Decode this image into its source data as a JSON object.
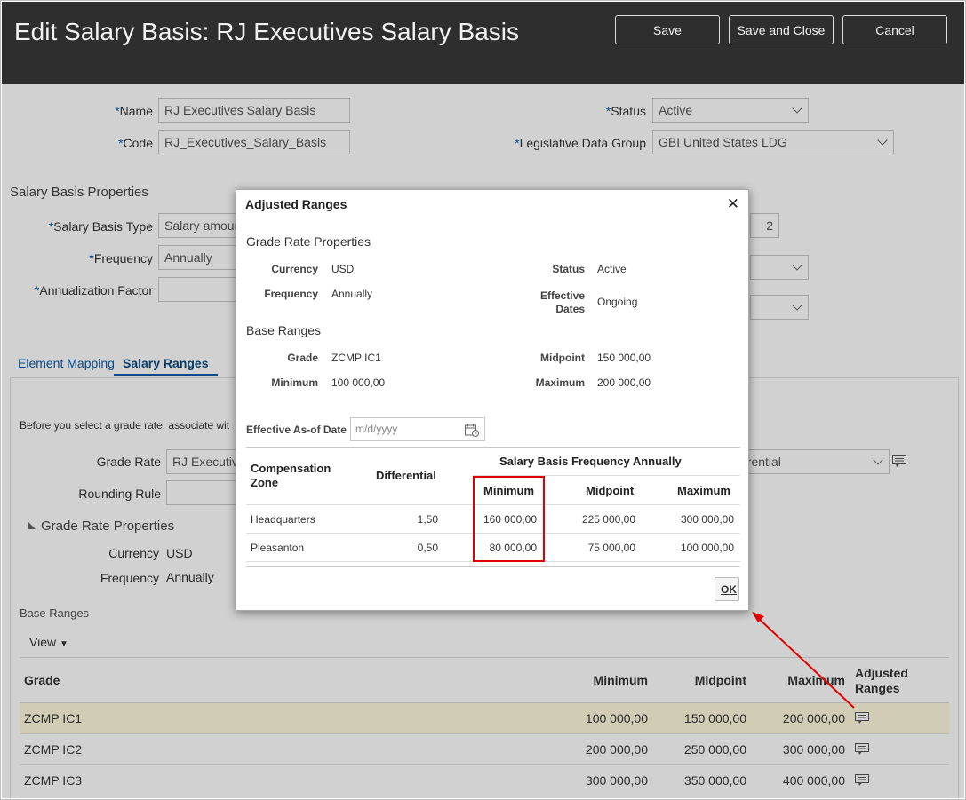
{
  "header": {
    "title": "Edit Salary Basis: RJ Executives Salary Basis",
    "save_label": "Save",
    "save_close_label": "Save and Close",
    "cancel_label": "Cancel"
  },
  "form": {
    "name_label": "Name",
    "name_value": "RJ Executives Salary Basis",
    "code_label": "Code",
    "code_value": "RJ_Executives_Salary_Basis",
    "status_label": "Status",
    "status_value": "Active",
    "ldg_label": "Legislative Data Group",
    "ldg_value": "GBI United States LDG",
    "required_mark": "*"
  },
  "properties": {
    "heading": "Salary Basis Properties",
    "type_label": "Salary Basis Type",
    "type_value": "Salary amoun",
    "frequency_label": "Frequency",
    "frequency_value": "Annually",
    "annualization_label": "Annualization Factor",
    "decimals_value": "2"
  },
  "tabs": [
    "Element Mapping",
    "Salary Ranges"
  ],
  "salary_ranges": {
    "intro": "Before you select a grade rate, associate wit",
    "grade_rate_label": "Grade Rate",
    "grade_rate_value": "RJ Executive",
    "grade_rate_right_value": "erential",
    "rounding_label": "Rounding Rule",
    "grp_heading": "Grade Rate Properties",
    "currency_label": "Currency",
    "currency_value": "USD",
    "frequency_label": "Frequency",
    "frequency_value": "Annually",
    "base_ranges_heading": "Base Ranges",
    "view_label": "View",
    "columns": [
      "Grade",
      "Minimum",
      "Midpoint",
      "Maximum",
      "Adjusted Ranges"
    ],
    "rows": [
      {
        "grade": "ZCMP IC1",
        "min": "100 000,00",
        "mid": "150 000,00",
        "max": "200 000,00"
      },
      {
        "grade": "ZCMP IC2",
        "min": "200 000,00",
        "mid": "250 000,00",
        "max": "300 000,00"
      },
      {
        "grade": "ZCMP IC3",
        "min": "300 000,00",
        "mid": "350 000,00",
        "max": "400 000,00"
      }
    ]
  },
  "dialog": {
    "title": "Adjusted Ranges",
    "close_glyph": "✕",
    "grp_heading": "Grade Rate Properties",
    "currency_label": "Currency",
    "currency_value": "USD",
    "frequency_label": "Frequency",
    "frequency_value": "Annually",
    "status_label": "Status",
    "status_value": "Active",
    "eff_label_1": "Effective",
    "eff_label_2": "Dates",
    "eff_value": "Ongoing",
    "base_heading": "Base Ranges",
    "grade_label": "Grade",
    "grade_value": "ZCMP IC1",
    "minimum_label": "Minimum",
    "minimum_value": "100 000,00",
    "midpoint_label": "Midpoint",
    "midpoint_value": "150 000,00",
    "maximum_label": "Maximum",
    "maximum_value": "200 000,00",
    "asof_label": "Effective As-of Date",
    "asof_placeholder": "m/d/yyyy",
    "table": {
      "zone_header_1": "Compensation",
      "zone_header_2": "Zone",
      "differential_header": "Differential",
      "group_header": "Salary Basis Frequency Annually",
      "min_header": "Minimum",
      "mid_header": "Midpoint",
      "max_header": "Maximum",
      "rows": [
        {
          "zone": "Headquarters",
          "diff": "1,50",
          "min": "160 000,00",
          "mid": "225 000,00",
          "max": "300 000,00"
        },
        {
          "zone": "Pleasanton",
          "diff": "0,50",
          "min": "80 000,00",
          "mid": "75 000,00",
          "max": "100 000,00"
        }
      ]
    },
    "ok_label": "OK"
  },
  "colors": {
    "header_bg": "#2e2e2e",
    "link": "#0a5ba8",
    "selected_row": "#fff9df",
    "annotation_red": "#e00000"
  }
}
